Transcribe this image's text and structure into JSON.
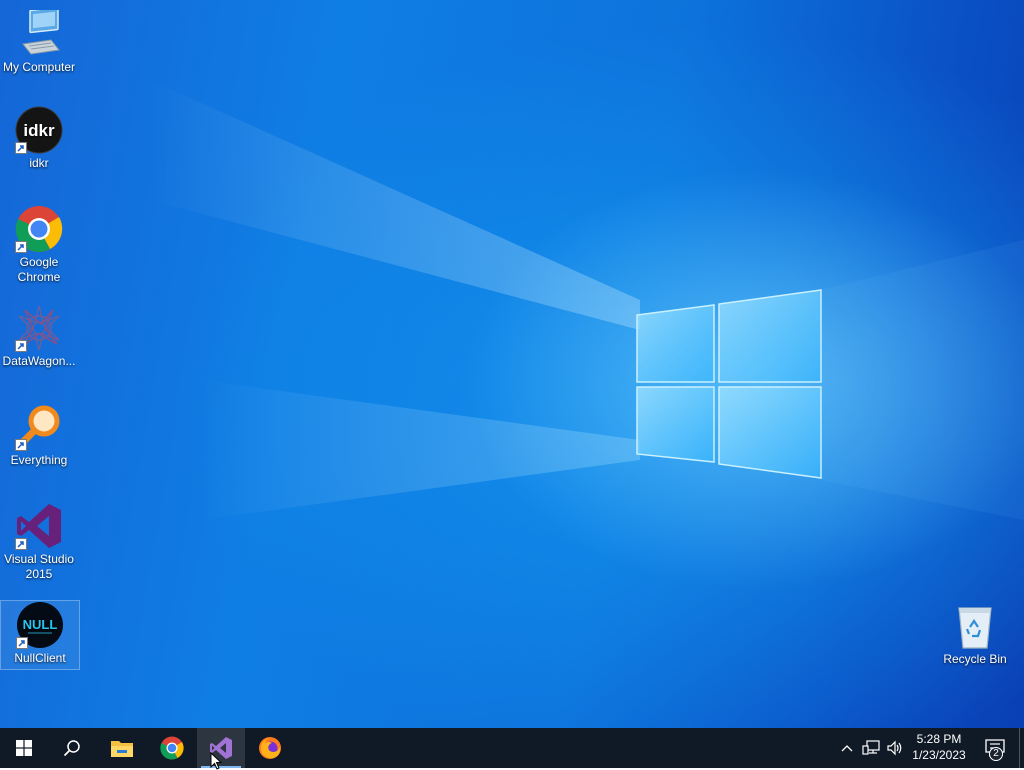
{
  "desktop": {
    "icons": [
      {
        "label": "My Computer",
        "icon": "computer-icon"
      },
      {
        "label": "idkr",
        "icon": "idkr-app-icon",
        "shortcut": true
      },
      {
        "label": "Google Chrome",
        "icon": "chrome-icon",
        "shortcut": true
      },
      {
        "label": "DataWagon...",
        "icon": "datawagon-icon",
        "shortcut": true
      },
      {
        "label": "Everything",
        "icon": "everything-search-icon",
        "shortcut": true
      },
      {
        "label": "Visual Studio 2015",
        "icon": "visual-studio-icon",
        "shortcut": true
      },
      {
        "label": "NullClient",
        "icon": "nullclient-icon",
        "shortcut": true,
        "selected": true
      },
      {
        "label": "Recycle Bin",
        "icon": "recycle-bin-icon"
      }
    ],
    "idkr_logo_text": "idkr",
    "nullclient_logo_text": "NULL"
  },
  "taskbar": {
    "start": {
      "icon": "windows-start-icon"
    },
    "search": {
      "icon": "search-icon"
    },
    "pinned": [
      {
        "name": "File Explorer",
        "icon": "file-explorer-icon",
        "running": false
      },
      {
        "name": "Google Chrome",
        "icon": "chrome-icon",
        "running": false
      },
      {
        "name": "Visual Studio 2015",
        "icon": "visual-studio-icon",
        "running": true,
        "active": true
      },
      {
        "name": "Firefox",
        "icon": "firefox-icon",
        "running": false
      }
    ],
    "tray": {
      "icons": [
        "chevron-up-icon",
        "network-icon",
        "volume-icon"
      ],
      "time": "5:28 PM",
      "date": "1/23/2023",
      "notification_count": "2",
      "notification_icon": "action-center-icon"
    }
  },
  "colors": {
    "taskbar": "#101a26",
    "desktop_accent": "#0f7ee4",
    "vs_purple": "#68217a",
    "everything_orange": "#f08a1c"
  }
}
